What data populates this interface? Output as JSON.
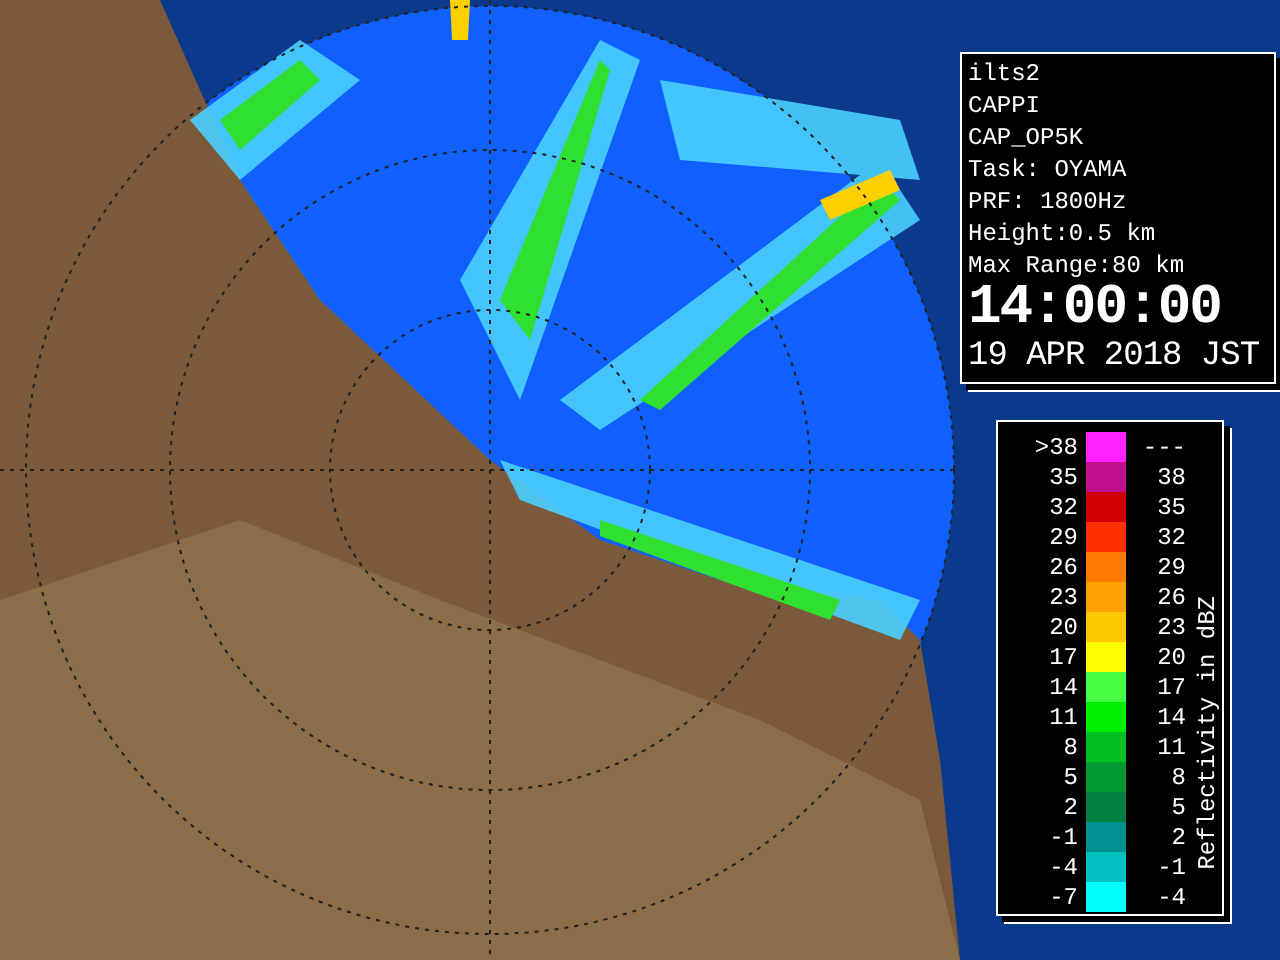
{
  "info_panel": {
    "lines": [
      "ilts2",
      "CAPPI",
      "CAP_OP5K",
      "Task: OYAMA",
      "PRF: 1800Hz",
      "Height:0.5 km",
      "Max Range:80 km"
    ],
    "time": "14:00:00",
    "date": "19 APR 2018 JST"
  },
  "legend": {
    "title": "Reflectivity in dBZ",
    "rows": [
      {
        "low": ">38",
        "high": "---",
        "color": "#ff22ff"
      },
      {
        "low": "35",
        "high": "38",
        "color": "#c0108f"
      },
      {
        "low": "32",
        "high": "35",
        "color": "#d00000"
      },
      {
        "low": "29",
        "high": "32",
        "color": "#ff3000"
      },
      {
        "low": "26",
        "high": "29",
        "color": "#ff7a00"
      },
      {
        "low": "23",
        "high": "26",
        "color": "#ffa000"
      },
      {
        "low": "20",
        "high": "23",
        "color": "#ffc800"
      },
      {
        "low": "17",
        "high": "20",
        "color": "#ffff00"
      },
      {
        "low": "14",
        "high": "17",
        "color": "#44ff44"
      },
      {
        "low": "11",
        "high": "14",
        "color": "#00ee00"
      },
      {
        "low": "8",
        "high": "11",
        "color": "#00c020"
      },
      {
        "low": "5",
        "high": "8",
        "color": "#009a30"
      },
      {
        "low": "2",
        "high": "5",
        "color": "#008040"
      },
      {
        "low": "-1",
        "high": "2",
        "color": "#009090"
      },
      {
        "low": "-4",
        "high": "-1",
        "color": "#00c0c0"
      },
      {
        "low": "-7",
        "high": "-4",
        "color": "#00ffff"
      }
    ]
  }
}
